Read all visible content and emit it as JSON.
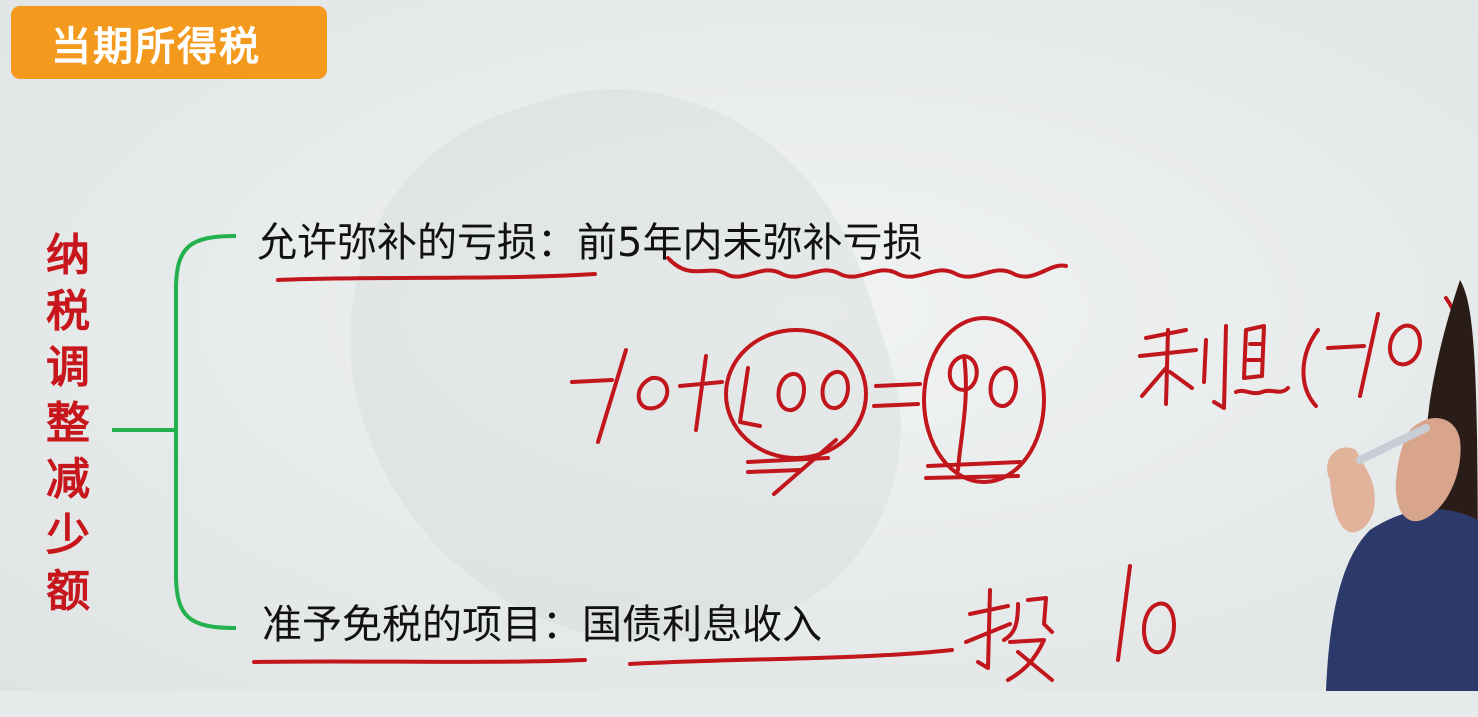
{
  "header": {
    "title": "当期所得税"
  },
  "sidebar": {
    "label": "纳税调整减少额"
  },
  "branches": [
    {
      "label": "允许弥补的亏损",
      "separator": "：",
      "detail": "前5年内未弥补亏损"
    },
    {
      "label": "准予免税的项目",
      "separator": "：",
      "detail": "国债利息收入"
    }
  ],
  "colors": {
    "badge": "#f39a1e",
    "sidebar_text": "#c8161d",
    "brace": "#22b14c",
    "handwriting": "#c0161c"
  },
  "handwriting_icons": [
    "equation-scribble-icon",
    "interest-note-scribble-icon",
    "tou-character-scribble-icon",
    "number-ten-scribble-icon"
  ]
}
